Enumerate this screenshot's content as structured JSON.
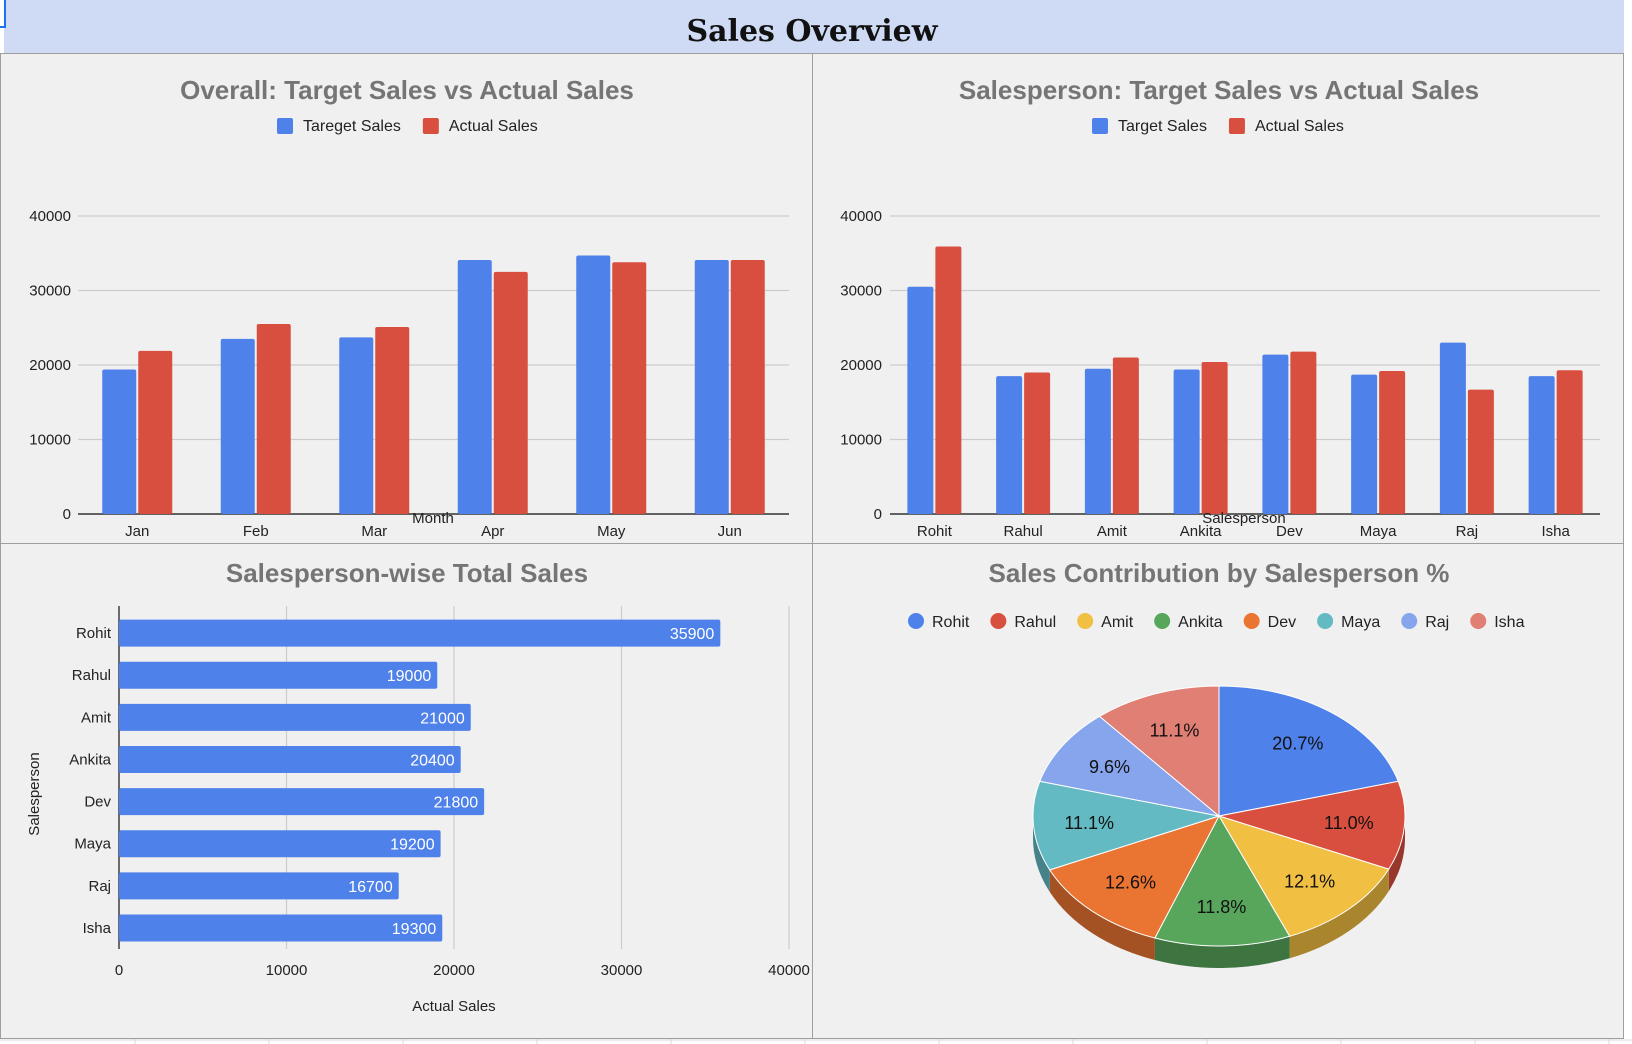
{
  "title": "Sales Overview",
  "colors": {
    "header_bg": "#cfdbf5",
    "panel_bg": "#f0f0f0",
    "blue": "#4f81ea",
    "red": "#d94f3f"
  },
  "chart_data": [
    {
      "type": "bar",
      "title": "Overall: Target Sales vs Actual Sales",
      "xlabel": "Month",
      "ylabel": "",
      "categories": [
        "Jan",
        "Feb",
        "Mar",
        "Apr",
        "May",
        "Jun"
      ],
      "series": [
        {
          "name": "Tareget Sales",
          "color": "#4f81ea",
          "values": [
            19400,
            23500,
            23700,
            34100,
            34700,
            34100
          ]
        },
        {
          "name": "Actual Sales",
          "color": "#d94f3f",
          "values": [
            21900,
            25500,
            25100,
            32500,
            33800,
            34100
          ]
        }
      ],
      "ylim": [
        0,
        40000
      ],
      "yticks": [
        "0",
        "10000",
        "20000",
        "30000",
        "40000"
      ],
      "grid": true,
      "legend": "top"
    },
    {
      "type": "bar",
      "title": "Salesperson: Target Sales vs Actual Sales",
      "xlabel": "Salesperson",
      "ylabel": "",
      "categories": [
        "Rohit",
        "Rahul",
        "Amit",
        "Ankita",
        "Dev",
        "Maya",
        "Raj",
        "Isha"
      ],
      "series": [
        {
          "name": "Target Sales",
          "color": "#4f81ea",
          "values": [
            30500,
            18500,
            19500,
            19400,
            21400,
            18700,
            23000,
            18500
          ]
        },
        {
          "name": "Actual Sales",
          "color": "#d94f3f",
          "values": [
            35900,
            19000,
            21000,
            20400,
            21800,
            19200,
            16700,
            19300
          ]
        }
      ],
      "ylim": [
        0,
        40000
      ],
      "yticks": [
        "0",
        "10000",
        "20000",
        "30000",
        "40000"
      ],
      "grid": true,
      "legend": "top"
    },
    {
      "type": "bar",
      "orientation": "horizontal",
      "title": "Salesperson-wise Total Sales",
      "xlabel": "Actual Sales",
      "ylabel": "Salesperson",
      "categories": [
        "Rohit",
        "Rahul",
        "Amit",
        "Ankita",
        "Dev",
        "Maya",
        "Raj",
        "Isha"
      ],
      "values": [
        35900,
        19000,
        21000,
        20400,
        21800,
        19200,
        16700,
        19300
      ],
      "color": "#4f81ea",
      "xlim": [
        0,
        40000
      ],
      "xticks": [
        "0",
        "10000",
        "20000",
        "30000",
        "40000"
      ],
      "grid": true,
      "data_labels": true
    },
    {
      "type": "pie",
      "style": "3d",
      "title": "Sales Contribution by Salesperson %",
      "labels": [
        "Rohit",
        "Rahul",
        "Amit",
        "Ankita",
        "Dev",
        "Maya",
        "Raj",
        "Isha"
      ],
      "values": [
        20.7,
        11.0,
        12.1,
        11.8,
        12.6,
        11.1,
        9.6,
        11.1
      ],
      "value_labels": [
        "20.7%",
        "11.0%",
        "12.1%",
        "11.8%",
        "12.6%",
        "11.1%",
        "9.6%",
        "11.1%"
      ],
      "colors": [
        "#4f81ea",
        "#d94f3f",
        "#f1bf42",
        "#58a65c",
        "#ea7432",
        "#63bac3",
        "#86a5ec",
        "#e07f73"
      ],
      "legend": "top"
    }
  ]
}
